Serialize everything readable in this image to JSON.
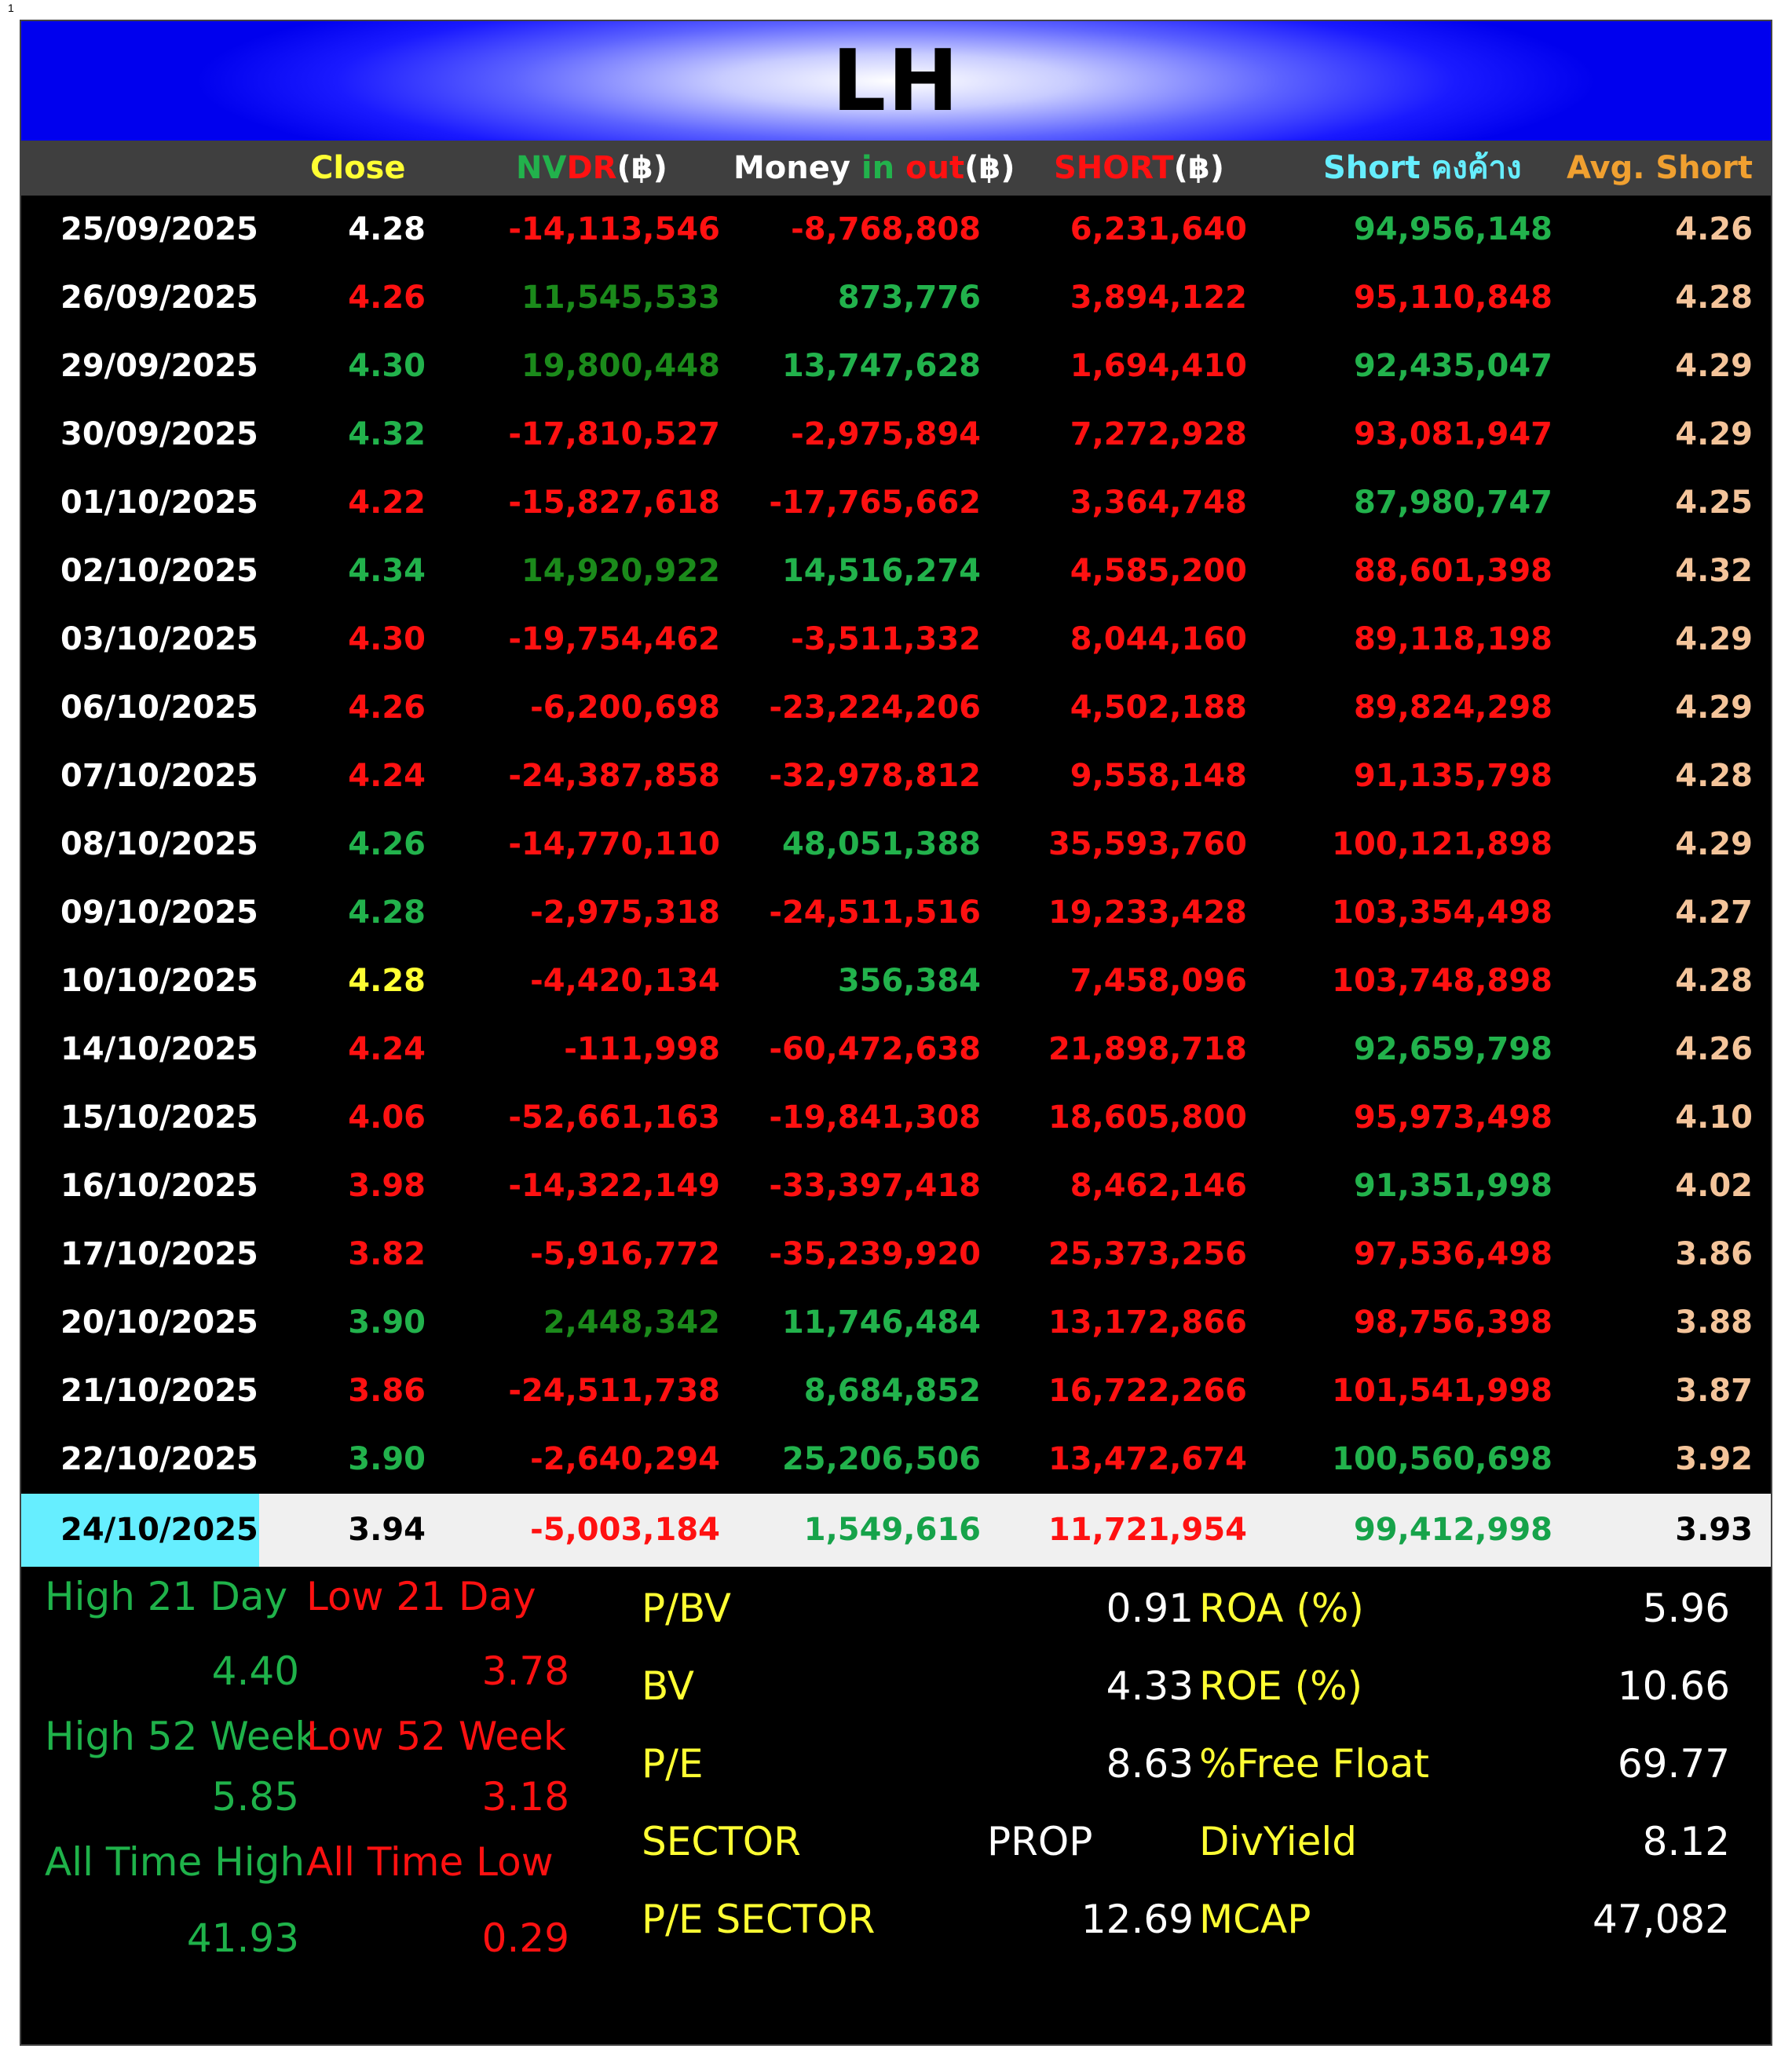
{
  "page_number": "1",
  "title": "LH",
  "headers": {
    "close": "Close",
    "nvdr_a": "NV",
    "nvdr_b": "DR",
    "nvdr_c": "(฿)",
    "money_a": "Money ",
    "money_b": "in ",
    "money_c": "out",
    "money_d": "(฿)",
    "short_a": "SHORT",
    "short_b": "(฿)",
    "outstanding_a": "Short ",
    "outstanding_b": "คงค้าง",
    "avg_short": "Avg. Short"
  },
  "rows": [
    {
      "date": "25/09/2025",
      "close": "4.28",
      "nvdr": "-14,113,546",
      "money": "-8,768,808",
      "short": "6,231,640",
      "outstanding": "94,956,148",
      "avg": "4.26"
    },
    {
      "date": "26/09/2025",
      "close": "4.26",
      "nvdr": "11,545,533",
      "money": "873,776",
      "short": "3,894,122",
      "outstanding": "95,110,848",
      "avg": "4.28"
    },
    {
      "date": "29/09/2025",
      "close": "4.30",
      "nvdr": "19,800,448",
      "money": "13,747,628",
      "short": "1,694,410",
      "outstanding": "92,435,047",
      "avg": "4.29"
    },
    {
      "date": "30/09/2025",
      "close": "4.32",
      "nvdr": "-17,810,527",
      "money": "-2,975,894",
      "short": "7,272,928",
      "outstanding": "93,081,947",
      "avg": "4.29"
    },
    {
      "date": "01/10/2025",
      "close": "4.22",
      "nvdr": "-15,827,618",
      "money": "-17,765,662",
      "short": "3,364,748",
      "outstanding": "87,980,747",
      "avg": "4.25"
    },
    {
      "date": "02/10/2025",
      "close": "4.34",
      "nvdr": "14,920,922",
      "money": "14,516,274",
      "short": "4,585,200",
      "outstanding": "88,601,398",
      "avg": "4.32"
    },
    {
      "date": "03/10/2025",
      "close": "4.30",
      "nvdr": "-19,754,462",
      "money": "-3,511,332",
      "short": "8,044,160",
      "outstanding": "89,118,198",
      "avg": "4.29"
    },
    {
      "date": "06/10/2025",
      "close": "4.26",
      "nvdr": "-6,200,698",
      "money": "-23,224,206",
      "short": "4,502,188",
      "outstanding": "89,824,298",
      "avg": "4.29"
    },
    {
      "date": "07/10/2025",
      "close": "4.24",
      "nvdr": "-24,387,858",
      "money": "-32,978,812",
      "short": "9,558,148",
      "outstanding": "91,135,798",
      "avg": "4.28"
    },
    {
      "date": "08/10/2025",
      "close": "4.26",
      "nvdr": "-14,770,110",
      "money": "48,051,388",
      "short": "35,593,760",
      "outstanding": "100,121,898",
      "avg": "4.29"
    },
    {
      "date": "09/10/2025",
      "close": "4.28",
      "nvdr": "-2,975,318",
      "money": "-24,511,516",
      "short": "19,233,428",
      "outstanding": "103,354,498",
      "avg": "4.27"
    },
    {
      "date": "10/10/2025",
      "close": "4.28",
      "nvdr": "-4,420,134",
      "money": "356,384",
      "short": "7,458,096",
      "outstanding": "103,748,898",
      "avg": "4.28"
    },
    {
      "date": "14/10/2025",
      "close": "4.24",
      "nvdr": "-111,998",
      "money": "-60,472,638",
      "short": "21,898,718",
      "outstanding": "92,659,798",
      "avg": "4.26"
    },
    {
      "date": "15/10/2025",
      "close": "4.06",
      "nvdr": "-52,661,163",
      "money": "-19,841,308",
      "short": "18,605,800",
      "outstanding": "95,973,498",
      "avg": "4.10"
    },
    {
      "date": "16/10/2025",
      "close": "3.98",
      "nvdr": "-14,322,149",
      "money": "-33,397,418",
      "short": "8,462,146",
      "outstanding": "91,351,998",
      "avg": "4.02"
    },
    {
      "date": "17/10/2025",
      "close": "3.82",
      "nvdr": "-5,916,772",
      "money": "-35,239,920",
      "short": "25,373,256",
      "outstanding": "97,536,498",
      "avg": "3.86"
    },
    {
      "date": "20/10/2025",
      "close": "3.90",
      "nvdr": "2,448,342",
      "money": "11,746,484",
      "short": "13,172,866",
      "outstanding": "98,756,398",
      "avg": "3.88"
    },
    {
      "date": "21/10/2025",
      "close": "3.86",
      "nvdr": "-24,511,738",
      "money": "8,684,852",
      "short": "16,722,266",
      "outstanding": "101,541,998",
      "avg": "3.87"
    },
    {
      "date": "22/10/2025",
      "close": "3.90",
      "nvdr": "-2,640,294",
      "money": "25,206,506",
      "short": "13,472,674",
      "outstanding": "100,560,698",
      "avg": "3.92"
    },
    {
      "date": "24/10/2025",
      "close": "3.94",
      "nvdr": "-5,003,184",
      "money": "1,549,616",
      "short": "11,721,954",
      "outstanding": "99,412,998",
      "avg": "3.93"
    }
  ],
  "row_colors": {
    "close": [
      "w",
      "r",
      "g",
      "g",
      "r",
      "g",
      "r",
      "r",
      "r",
      "g",
      "g",
      "y",
      "r",
      "r",
      "r",
      "r",
      "g",
      "r",
      "g",
      "k"
    ],
    "nvdr": [
      "r",
      "dg",
      "dg",
      "r",
      "r",
      "dg",
      "r",
      "r",
      "r",
      "r",
      "r",
      "r",
      "r",
      "r",
      "r",
      "r",
      "dg",
      "r",
      "r",
      "r"
    ],
    "money": [
      "r",
      "g",
      "g",
      "r",
      "r",
      "g",
      "r",
      "r",
      "r",
      "g",
      "r",
      "g",
      "r",
      "r",
      "r",
      "r",
      "g",
      "g",
      "g",
      "lastg"
    ],
    "outstanding": [
      "g",
      "r",
      "g",
      "r",
      "g",
      "r",
      "r",
      "r",
      "r",
      "r",
      "r",
      "r",
      "g",
      "r",
      "g",
      "r",
      "r",
      "r",
      "g",
      "lastg"
    ]
  },
  "colors": {
    "green": "#22b24c",
    "dark_green": "#1b8a1b",
    "red": "#ff1111",
    "yellow": "#ffff33",
    "cyan": "#66eeff",
    "peach": "#f4c49a",
    "banner_blue": "#1a1aff"
  },
  "ranges": {
    "high21_label": "High 21 Day",
    "low21_label": "Low 21 Day",
    "high21": "4.40",
    "low21": "3.78",
    "high52_label": "High 52 Week",
    "low52_label": "Low 52 Week",
    "high52": "5.85",
    "low52": "3.18",
    "ath_label": "All Time High",
    "atl_label": "All Time Low",
    "ath": "41.93",
    "atl": "0.29"
  },
  "stats_left": [
    {
      "label": "P/BV",
      "value": "0.91"
    },
    {
      "label": "BV",
      "value": "4.33"
    },
    {
      "label": "P/E",
      "value": "8.63"
    },
    {
      "label": "SECTOR",
      "value": "PROP"
    },
    {
      "label": "P/E SECTOR",
      "value": "12.69"
    }
  ],
  "stats_right": [
    {
      "label": "ROA (%)",
      "value": "5.96"
    },
    {
      "label": "ROE (%)",
      "value": "10.66"
    },
    {
      "label": "%Free Float",
      "value": "69.77"
    },
    {
      "label": "DivYield",
      "value": "8.12"
    },
    {
      "label": "MCAP",
      "value": "47,082"
    }
  ]
}
